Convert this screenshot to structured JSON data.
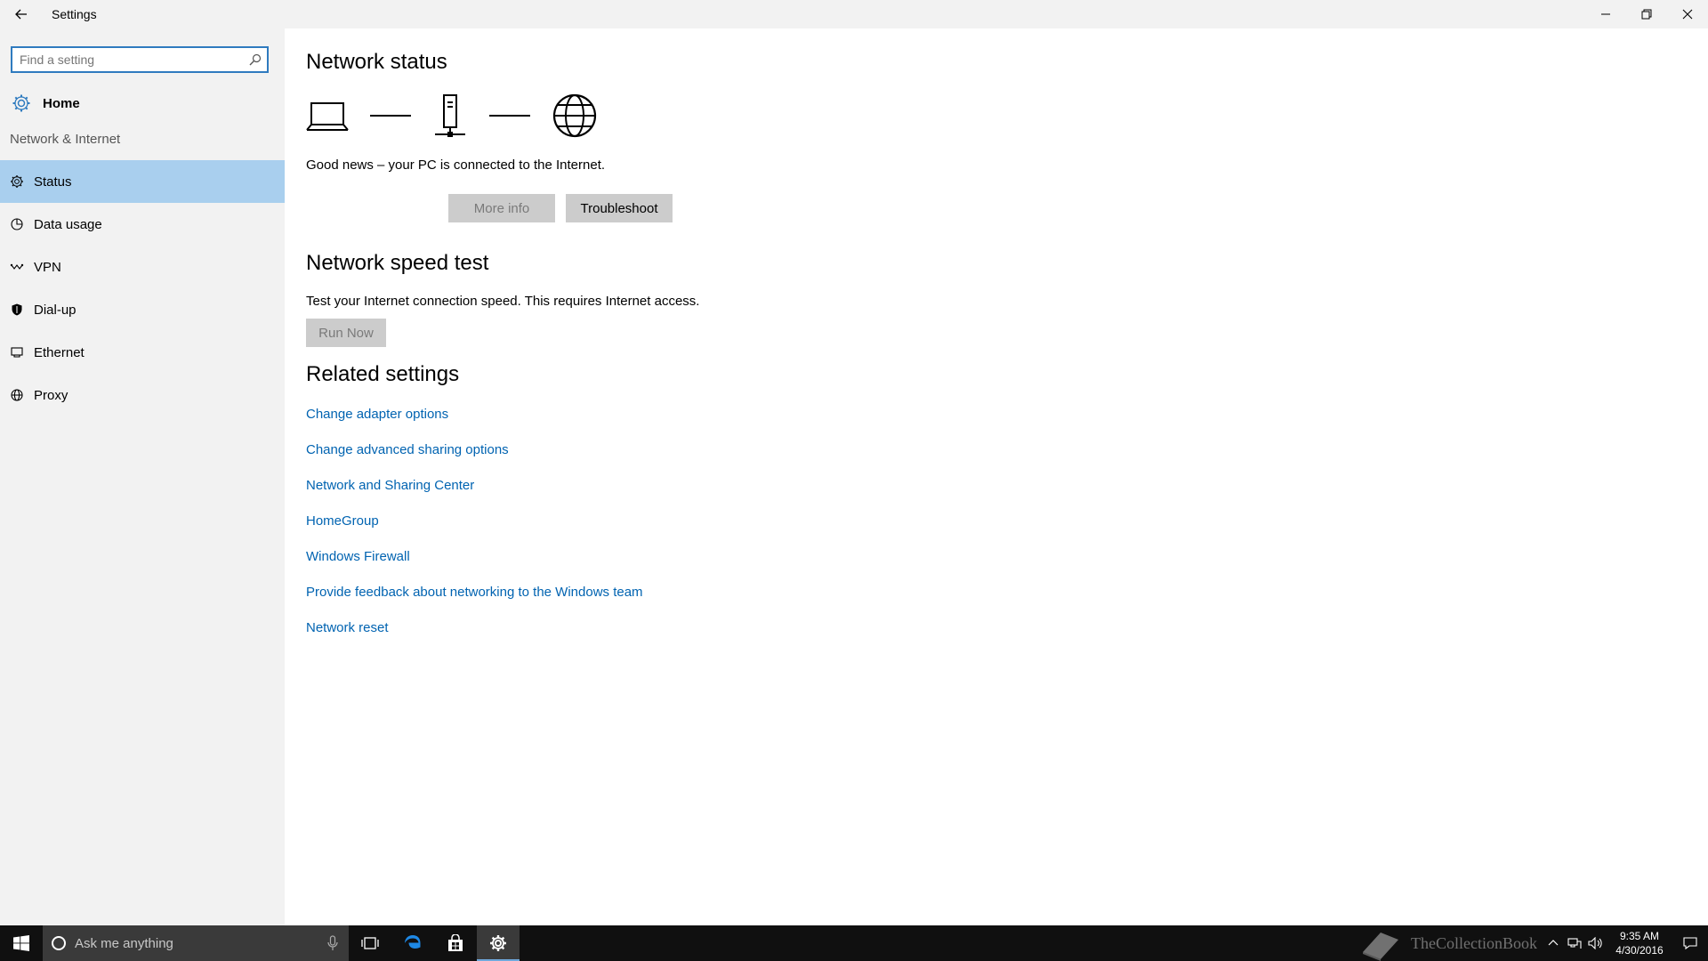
{
  "window": {
    "title": "Settings"
  },
  "sidebar": {
    "search_placeholder": "Find a setting",
    "home_label": "Home",
    "section_label": "Network & Internet",
    "items": [
      {
        "label": "Status",
        "icon": "gear-icon",
        "active": true
      },
      {
        "label": "Data usage",
        "icon": "pie-chart-icon",
        "active": false
      },
      {
        "label": "VPN",
        "icon": "vpn-icon",
        "active": false
      },
      {
        "label": "Dial-up",
        "icon": "dialup-icon",
        "active": false
      },
      {
        "label": "Ethernet",
        "icon": "ethernet-icon",
        "active": false
      },
      {
        "label": "Proxy",
        "icon": "globe-icon",
        "active": false
      }
    ]
  },
  "main": {
    "status_title": "Network status",
    "status_text": "Good news – your PC is connected to the Internet.",
    "more_info_label": "More info",
    "troubleshoot_label": "Troubleshoot",
    "speed_title": "Network speed test",
    "speed_text": "Test your Internet connection speed. This requires Internet access.",
    "run_now_label": "Run Now",
    "related_title": "Related settings",
    "related_links": [
      "Change adapter options",
      "Change advanced sharing options",
      "Network and Sharing Center",
      "HomeGroup",
      "Windows Firewall",
      "Provide feedback about networking to the Windows team",
      "Network reset"
    ]
  },
  "taskbar": {
    "search_placeholder": "Ask me anything",
    "watermark": "TheCollectionBook",
    "time": "9:35 AM",
    "date": "4/30/2016"
  },
  "colors": {
    "accent": "#2f7bbf",
    "active_nav": "#a9cfee",
    "link": "#0063b1",
    "sidebar_bg": "#f2f2f2"
  }
}
